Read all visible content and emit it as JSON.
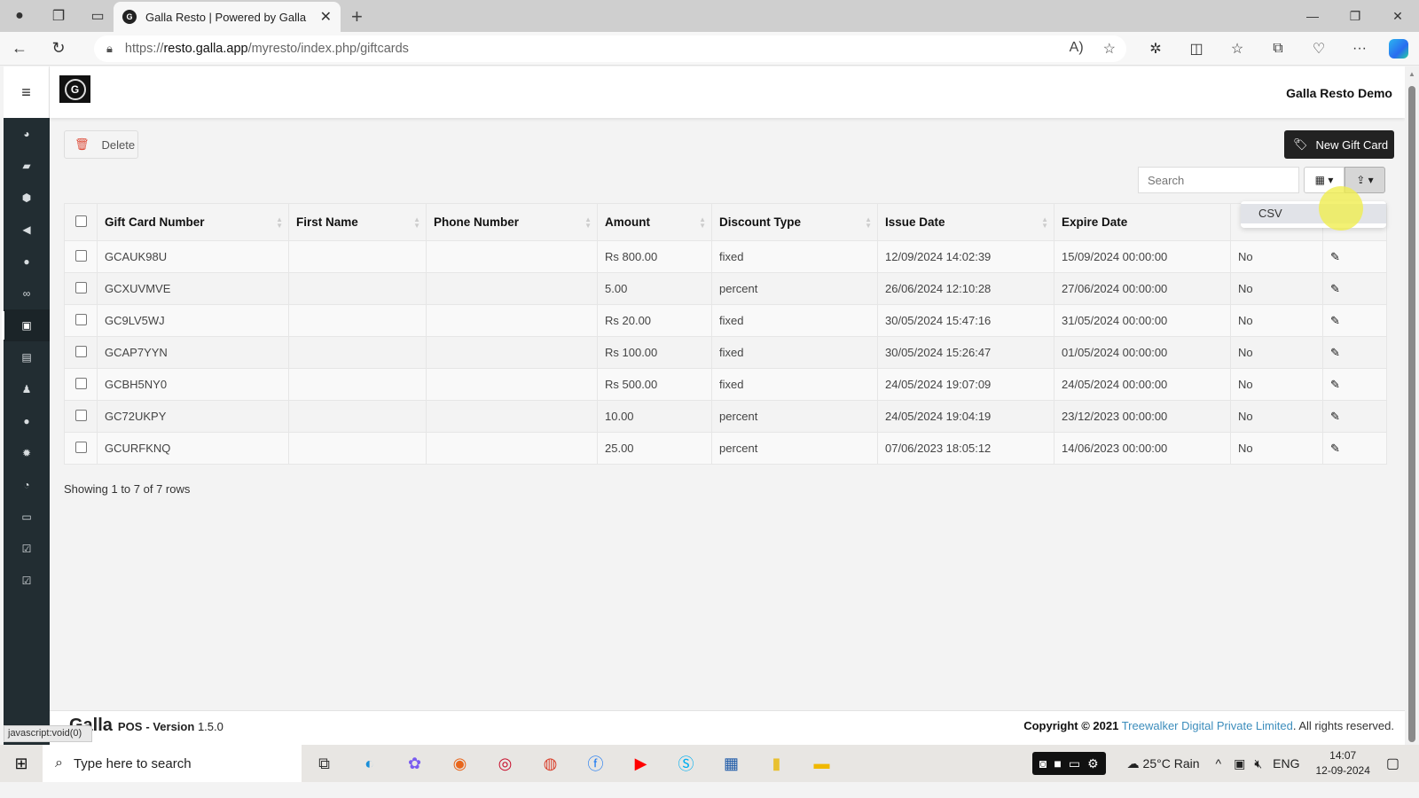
{
  "browser": {
    "tab_title": "Galla Resto | Powered by Galla",
    "url_scheme": "https://",
    "url_host": "resto.galla.app",
    "url_path": "/myresto/index.php/giftcards",
    "status_text": "javascript:void(0)"
  },
  "header": {
    "brand": "Galla Resto Demo"
  },
  "sidebar": {
    "items": [
      {
        "icon": "dashboard-icon",
        "glyph": "◕"
      },
      {
        "icon": "folder-open-icon",
        "glyph": "▰"
      },
      {
        "icon": "cube-icon",
        "glyph": "⬢"
      },
      {
        "icon": "bullhorn-icon",
        "glyph": "◀"
      },
      {
        "icon": "user-circle-icon",
        "glyph": "●"
      },
      {
        "icon": "handshake-icon",
        "glyph": "∞"
      },
      {
        "icon": "gift-icon",
        "glyph": "▣",
        "active": true
      },
      {
        "icon": "basket-icon",
        "glyph": "▤"
      },
      {
        "icon": "users-icon",
        "glyph": "♟"
      },
      {
        "icon": "map-marker-icon",
        "glyph": "●"
      },
      {
        "icon": "cog-icon",
        "glyph": "✹"
      },
      {
        "icon": "pie-chart-icon",
        "glyph": "◔"
      },
      {
        "icon": "money-icon",
        "glyph": "▭"
      },
      {
        "icon": "check-square-icon",
        "glyph": "☑"
      },
      {
        "icon": "check-square-icon",
        "glyph": "☑"
      }
    ]
  },
  "toolbar": {
    "delete_label": "Delete",
    "new_label": "New Gift Card",
    "search_placeholder": "Search",
    "export_menu": [
      "CSV"
    ]
  },
  "table": {
    "columns": [
      "Gift Card Number",
      "First Name",
      "Phone Number",
      "Amount",
      "Discount Type",
      "Issue Date",
      "Expire Date",
      "",
      ""
    ],
    "rows": [
      {
        "number": "GCAUK98U",
        "first_name": "",
        "phone": "",
        "amount": "Rs 800.00",
        "type": "fixed",
        "issue": "12/09/2024 14:02:39",
        "expire": "15/09/2024 00:00:00",
        "used": "No"
      },
      {
        "number": "GCXUVMVE",
        "first_name": "",
        "phone": "",
        "amount": "5.00",
        "type": "percent",
        "issue": "26/06/2024 12:10:28",
        "expire": "27/06/2024 00:00:00",
        "used": "No"
      },
      {
        "number": "GC9LV5WJ",
        "first_name": "",
        "phone": "",
        "amount": "Rs 20.00",
        "type": "fixed",
        "issue": "30/05/2024 15:47:16",
        "expire": "31/05/2024 00:00:00",
        "used": "No"
      },
      {
        "number": "GCAP7YYN",
        "first_name": "",
        "phone": "",
        "amount": "Rs 100.00",
        "type": "fixed",
        "issue": "30/05/2024 15:26:47",
        "expire": "01/05/2024 00:00:00",
        "used": "No"
      },
      {
        "number": "GCBH5NY0",
        "first_name": "",
        "phone": "",
        "amount": "Rs 500.00",
        "type": "fixed",
        "issue": "24/05/2024 19:07:09",
        "expire": "24/05/2024 00:00:00",
        "used": "No"
      },
      {
        "number": "GC72UKPY",
        "first_name": "",
        "phone": "",
        "amount": "10.00",
        "type": "percent",
        "issue": "24/05/2024 19:04:19",
        "expire": "23/12/2023 00:00:00",
        "used": "No"
      },
      {
        "number": "GCURFKNQ",
        "first_name": "",
        "phone": "",
        "amount": "25.00",
        "type": "percent",
        "issue": "07/06/2023 18:05:12",
        "expire": "14/06/2023 00:00:00",
        "used": "No"
      }
    ],
    "pagination_text": "Showing 1 to 7 of 7 rows"
  },
  "footer": {
    "product": "Galla",
    "pos": "POS",
    "version_label": "- Version",
    "version": "1.5.0",
    "copyright": "Copyright © 2021",
    "company": "Treewalker Digital Private Limited",
    "rights": ". All rights reserved."
  },
  "taskbar": {
    "search_placeholder": "Type here to search",
    "weather": "25°C  Rain",
    "lang": "ENG",
    "time": "14:07",
    "date": "12-09-2024"
  },
  "colors": {
    "sidebar_bg": "#222d32",
    "link": "#3c8dbc",
    "danger": "#dd4b39",
    "primary_dark": "#222222"
  }
}
